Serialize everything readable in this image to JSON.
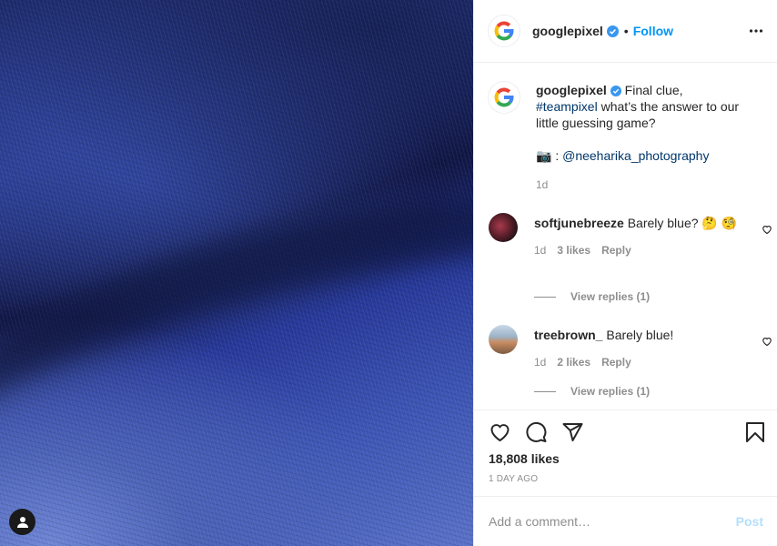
{
  "post": {
    "username": "googlepixel",
    "follow_label": "Follow",
    "dot": "•",
    "caption_text": " Final clue, ",
    "caption_hashtag": "#teampixel",
    "caption_rest": " what’s the answer to our little guessing game?",
    "credit_icon": "📷",
    "credit_sep": " : ",
    "credit_handle": "@neeharika_photography",
    "caption_age": "1d",
    "likes": "18,808 likes",
    "posted_ago": "1 DAY AGO"
  },
  "comments": [
    {
      "username": "softjunebreeze",
      "text": "Barely blue? 🤔 🧐",
      "age": "1d",
      "likes": "3 likes",
      "reply_label": "Reply",
      "view_replies": "View replies (1)"
    },
    {
      "username": "treebrown_",
      "text": "Barely blue!",
      "age": "1d",
      "likes": "2 likes",
      "reply_label": "Reply",
      "view_replies": "View replies (1)"
    }
  ],
  "comment_box": {
    "placeholder": "Add a comment…",
    "post_label": "Post"
  },
  "colors": {
    "accent": "#0095f6",
    "verified": "#3897f0",
    "post_disabled": "#b2dffc"
  },
  "icons": [
    "google-logo-icon",
    "verified-badge-icon",
    "more-options-icon",
    "camera-icon",
    "heart-icon",
    "comment-icon",
    "share-icon",
    "bookmark-icon",
    "user-tag-icon"
  ]
}
